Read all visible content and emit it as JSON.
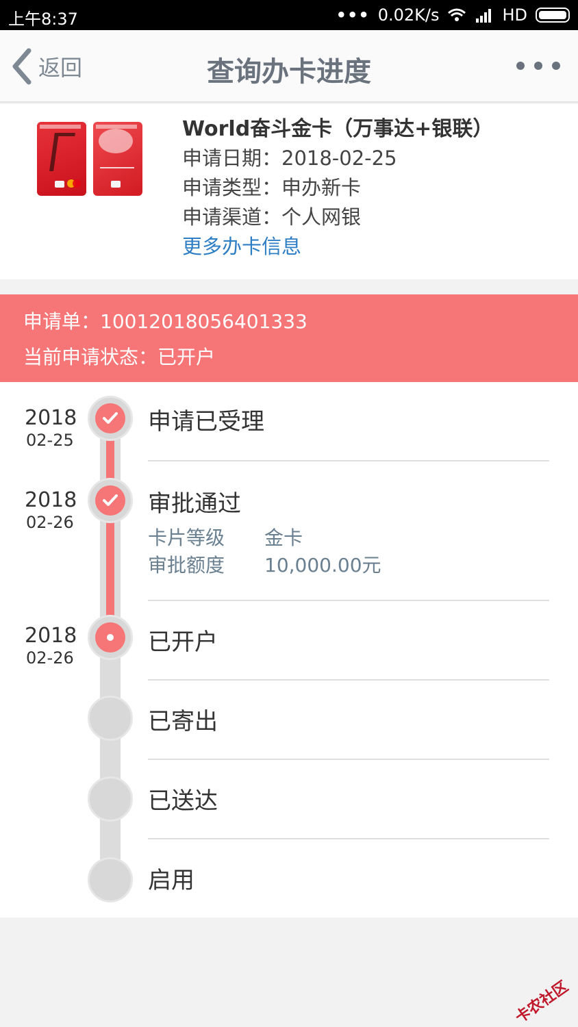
{
  "status_bar": {
    "time": "上午8:37",
    "dots": "•••",
    "speed": "0.02K/s",
    "network": "HD"
  },
  "nav": {
    "back_label": "返回",
    "title": "查询办卡进度"
  },
  "card": {
    "name": "World奋斗金卡（万事达+银联）",
    "apply_date": "申请日期：2018-02-25",
    "apply_type": "申请类型：申办新卡",
    "apply_channel": "申请渠道：个人网银",
    "more_info": "更多办卡信息"
  },
  "application": {
    "number": "申请单：10012018056401333",
    "status": "当前申请状态：已开户"
  },
  "timeline": {
    "steps": [
      {
        "year": "2018",
        "date": "02-25",
        "label": "申请已受理",
        "state": "done"
      },
      {
        "year": "2018",
        "date": "02-26",
        "label": "审批通过",
        "state": "done",
        "details": [
          {
            "key": "卡片等级",
            "value": "金卡"
          },
          {
            "key": "审批额度",
            "value": "10,000.00元"
          }
        ]
      },
      {
        "year": "2018",
        "date": "02-26",
        "label": "已开户",
        "state": "current"
      },
      {
        "label": "已寄出",
        "state": "pending"
      },
      {
        "label": "已送达",
        "state": "pending"
      },
      {
        "label": "启用",
        "state": "pending"
      }
    ]
  },
  "watermark": "卡农社区",
  "colors": {
    "accent": "#f67677",
    "link": "#2d7ec4",
    "pending": "#d8d8d8"
  }
}
